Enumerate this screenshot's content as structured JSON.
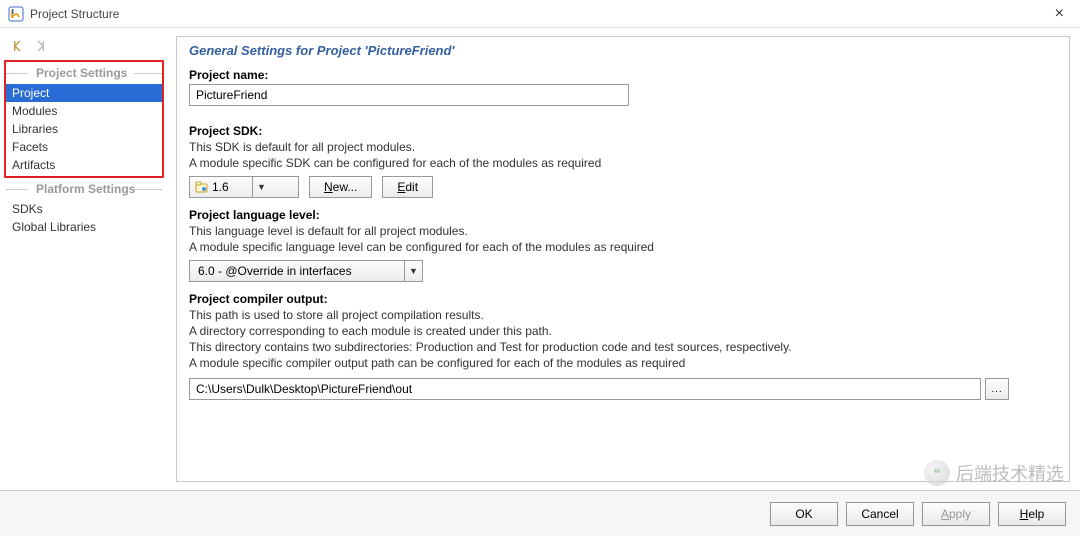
{
  "window": {
    "title": "Project Structure",
    "close_glyph": "×"
  },
  "sidebar": {
    "project_settings_header": "Project Settings",
    "platform_settings_header": "Platform Settings",
    "project_items": [
      {
        "label": "Project",
        "selected": true
      },
      {
        "label": "Modules",
        "selected": false
      },
      {
        "label": "Libraries",
        "selected": false
      },
      {
        "label": "Facets",
        "selected": false
      },
      {
        "label": "Artifacts",
        "selected": false
      }
    ],
    "platform_items": [
      {
        "label": "SDKs"
      },
      {
        "label": "Global Libraries"
      }
    ]
  },
  "panel": {
    "title": "General Settings for Project 'PictureFriend'",
    "project_name_label": "Project name:",
    "project_name_value": "PictureFriend",
    "sdk_label": "Project SDK:",
    "sdk_desc1": "This SDK is default for all project modules.",
    "sdk_desc2": "A module specific SDK can be configured for each of the modules as required",
    "sdk_value": "1.6",
    "sdk_new_label": "New...",
    "sdk_new_ul": "N",
    "sdk_edit_label": "Edit",
    "sdk_edit_ul": "E",
    "lang_label": "Project language level:",
    "lang_desc1": "This language level is default for all project modules.",
    "lang_desc2": "A module specific language level can be configured for each of the modules as required",
    "lang_value": "6.0 - @Override in interfaces",
    "out_label": "Project compiler output:",
    "out_desc1": "This path is used to store all project compilation results.",
    "out_desc2": "A directory corresponding to each module is created under this path.",
    "out_desc3": "This directory contains two subdirectories: Production and Test for production code and test sources, respectively.",
    "out_desc4": "A module specific compiler output path can be configured for each of the modules as required",
    "out_value": "C:\\Users\\Dulk\\Desktop\\PictureFriend\\out",
    "browse_glyph": "..."
  },
  "buttons": {
    "ok": "OK",
    "cancel": "Cancel",
    "apply": "Apply",
    "apply_ul": "A",
    "help": "Help",
    "help_ul": "H"
  },
  "watermark": {
    "text": "后端技术精选",
    "icon_glyph": "❝"
  }
}
